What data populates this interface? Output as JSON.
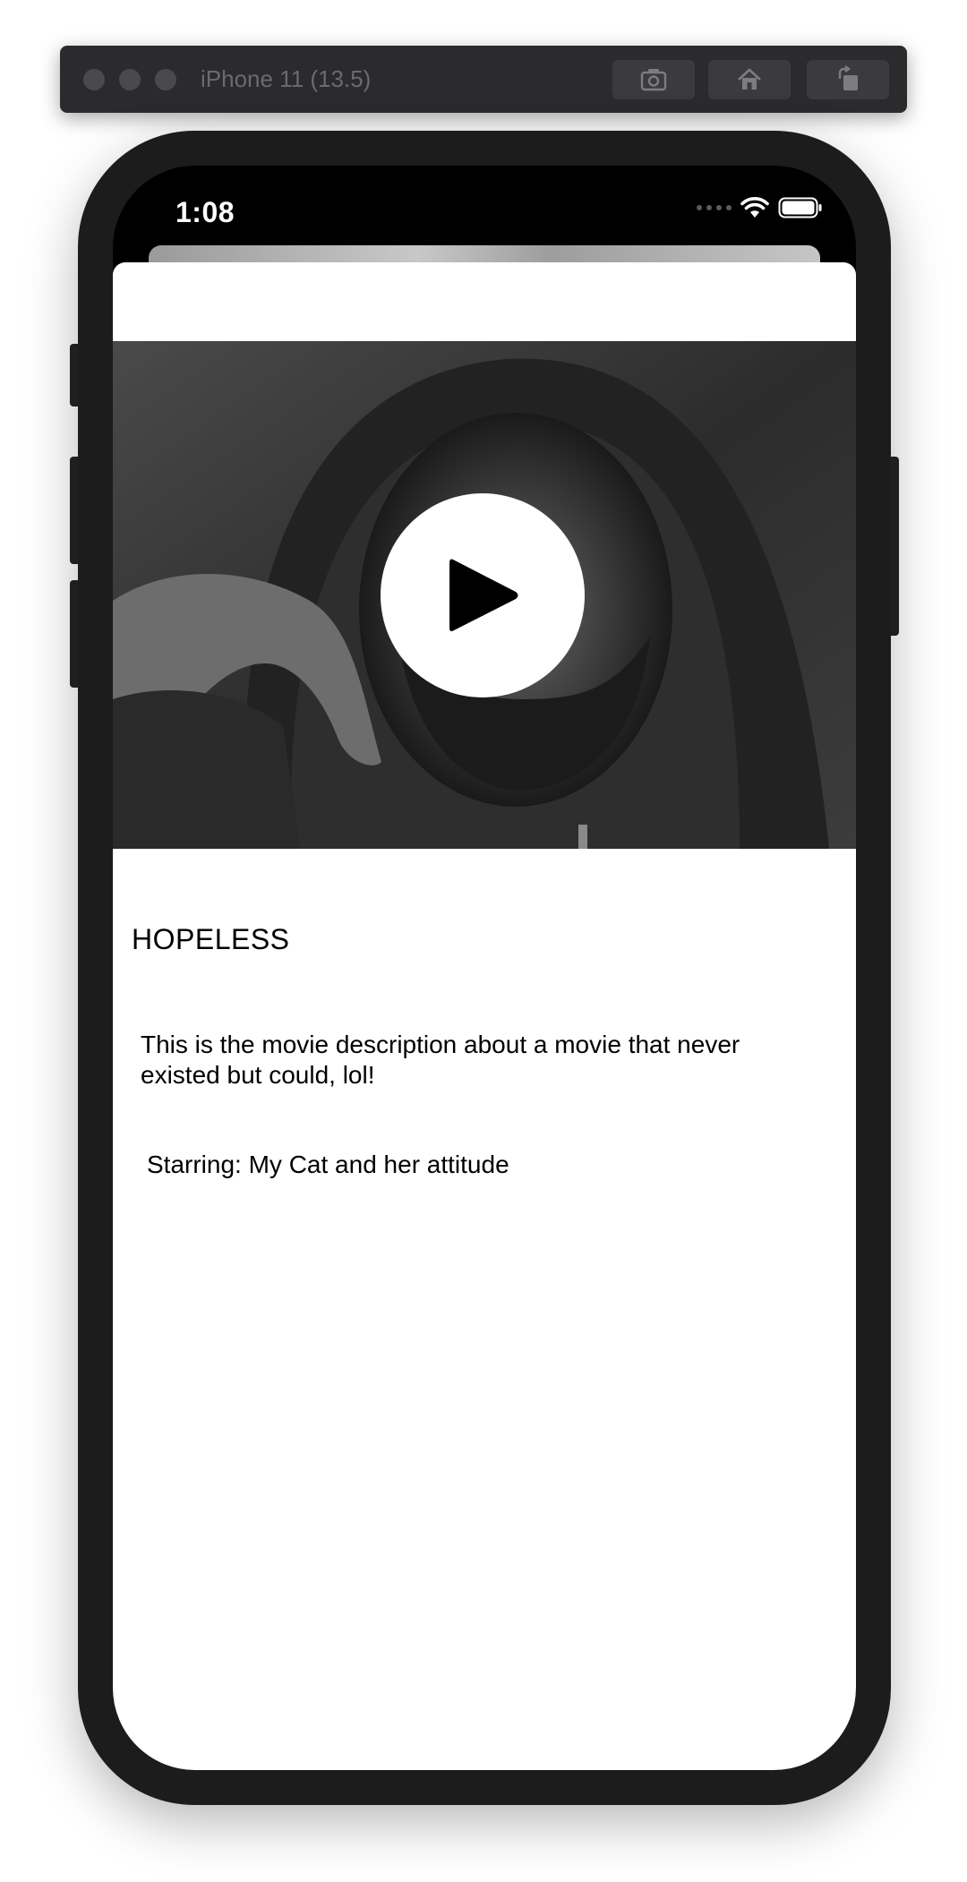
{
  "simulator": {
    "title": "iPhone 11 (13.5)",
    "buttons": [
      {
        "icon": "camera-icon"
      },
      {
        "icon": "home-icon"
      },
      {
        "icon": "rotate-icon"
      }
    ]
  },
  "status_bar": {
    "time": "1:08",
    "icons": [
      "cellular-signal-icon",
      "wifi-icon",
      "battery-icon"
    ]
  },
  "video": {
    "description": "black-and-white portrait still",
    "play_icon": "play-icon"
  },
  "movie": {
    "title": "HOPELESS",
    "description": "This is the movie description about a movie that never existed but could, lol!",
    "cast": "Starring: My Cat and her attitude"
  },
  "colors": {
    "sheet_background": "#ffffff",
    "device_frame": "#1c1c1d",
    "toolbar": "#2b2b2d"
  }
}
